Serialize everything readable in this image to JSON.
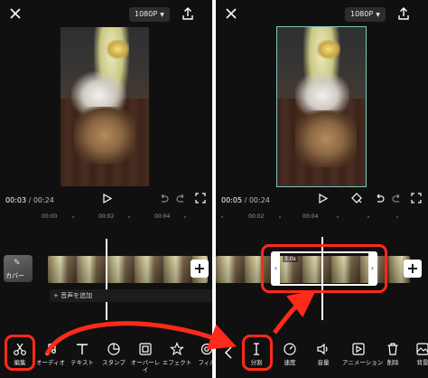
{
  "left_panel": {
    "resolution": "1080P",
    "timecode_current": "00:03",
    "timecode_total": "00:24",
    "ruler": [
      "00:00",
      "00:02",
      "00:04"
    ],
    "cover_label": "カバー",
    "audio_label": "+ 音声を追加",
    "toolbar": [
      {
        "label": "編集",
        "icon": "scissors-icon"
      },
      {
        "label": "オーディオ",
        "icon": "music-note-icon"
      },
      {
        "label": "テキスト",
        "icon": "text-icon"
      },
      {
        "label": "スタンプ",
        "icon": "sticker-icon"
      },
      {
        "label": "オーバーレイ",
        "icon": "overlay-icon"
      },
      {
        "label": "エフェクト",
        "icon": "effect-star-icon"
      },
      {
        "label": "フィル",
        "icon": "filter-icon"
      }
    ]
  },
  "right_panel": {
    "resolution": "1080P",
    "timecode_current": "00:05",
    "timecode_total": "00:24",
    "ruler": [
      "00:02",
      "00:04"
    ],
    "clip_duration": "3.0s",
    "toolbar": [
      {
        "label": "分割",
        "icon": "split-icon"
      },
      {
        "label": "速度",
        "icon": "speed-icon"
      },
      {
        "label": "音量",
        "icon": "volume-icon"
      },
      {
        "label": "アニメーション",
        "icon": "animation-icon"
      },
      {
        "label": "削除",
        "icon": "trash-icon"
      },
      {
        "label": "背景",
        "icon": "background-icon"
      }
    ]
  },
  "colors": {
    "background": "#101010",
    "highlight": "#ff2a1a",
    "selection_outline": "#7fc7b9"
  }
}
